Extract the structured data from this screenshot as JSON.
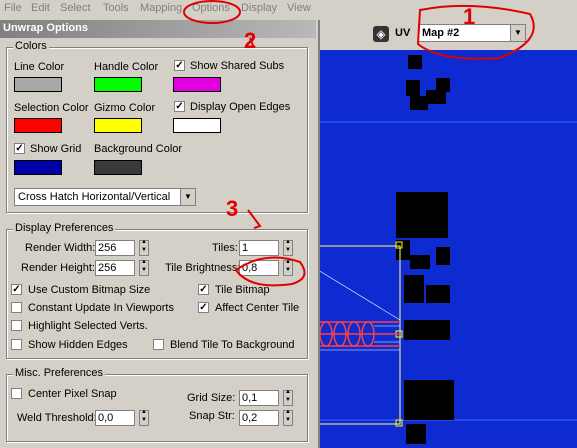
{
  "menu": [
    "File",
    "Edit",
    "Select",
    "Tools",
    "Mapping",
    "Options",
    "Display",
    "View"
  ],
  "dialog": {
    "title": "Unwrap Options"
  },
  "colors": {
    "group_title": "Colors",
    "line_color": {
      "label": "Line Color",
      "value": "#a8a8a8"
    },
    "handle_color": {
      "label": "Handle Color",
      "value": "#00ff00"
    },
    "show_shared_subs": {
      "label": "Show Shared Subs",
      "checked": true,
      "value": "#e000e0"
    },
    "selection_color": {
      "label": "Selection Color",
      "value": "#ff0000"
    },
    "gizmo_color": {
      "label": "Gizmo Color",
      "value": "#ffff00"
    },
    "display_open_edges": {
      "label": "Display Open Edges",
      "checked": true,
      "value": "#ffffff"
    },
    "show_grid": {
      "label": "Show Grid",
      "checked": true,
      "value": "#0000a8"
    },
    "background_color": {
      "label": "Background Color",
      "value": "#3a3a3a"
    },
    "pattern": "Cross Hatch Horizontal/Vertical"
  },
  "display_prefs": {
    "group_title": "Display Preferences",
    "render_width_label": "Render Width:",
    "render_width": "256",
    "render_height_label": "Render Height:",
    "render_height": "256",
    "tiles_label": "Tiles:",
    "tiles": "1",
    "tile_brightness_label": "Tile Brightness:",
    "tile_brightness": "0,8",
    "use_custom_bitmap_size": "Use Custom Bitmap Size",
    "tile_bitmap": "Tile Bitmap",
    "constant_update": "Constant Update In Viewports",
    "affect_center_tile": "Affect Center Tile",
    "highlight_selected": "Highlight Selected Verts.",
    "show_hidden_edges": "Show Hidden Edges",
    "blend_tile": "Blend Tile To Background"
  },
  "misc": {
    "group_title": "Misc. Preferences",
    "center_pixel_snap": "Center Pixel Snap",
    "grid_size_label": "Grid Size:",
    "grid_size": "0,1",
    "weld_threshold_label": "Weld Threshold:",
    "weld_threshold": "0,0",
    "snap_str_label": "Snap Str:",
    "snap_str": "0,2"
  },
  "uv_toolbar": {
    "uv_label": "UV",
    "map": "Map #2"
  },
  "annotations": [
    "1",
    "2",
    "3"
  ]
}
